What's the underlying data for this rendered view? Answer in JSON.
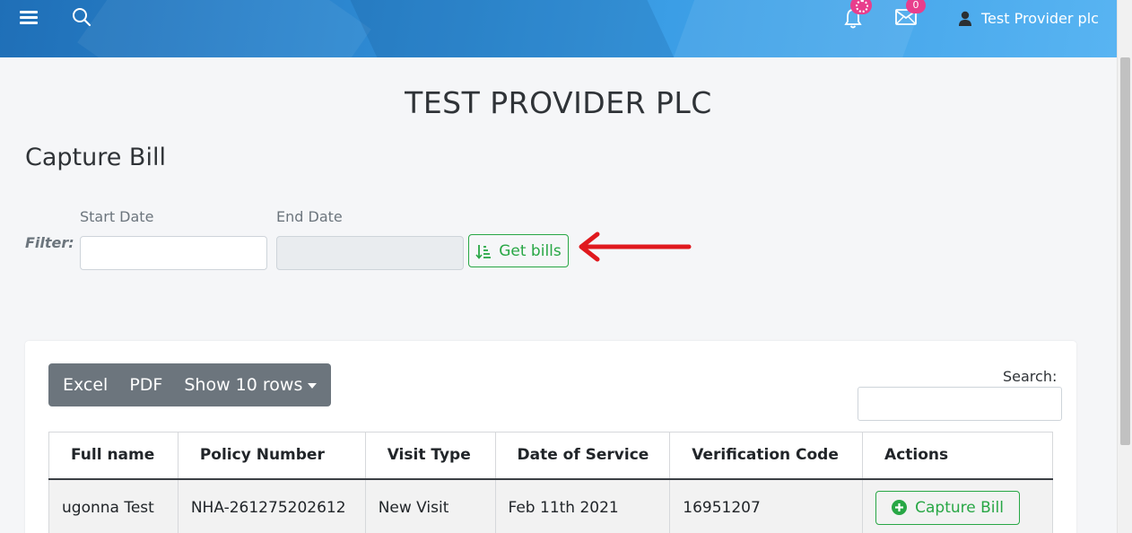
{
  "header": {
    "user_name": "Test Provider plc",
    "mail_count": "0",
    "accent_color": "#2e8ad3"
  },
  "page": {
    "company_name": "TEST PROVIDER PLC",
    "title": "Capture Bill"
  },
  "filter": {
    "label": "Filter:",
    "start_label": "Start Date",
    "start_value": "",
    "end_label": "End Date",
    "end_value": "",
    "get_bills_label": "Get bills"
  },
  "table_tools": {
    "excel_label": "Excel",
    "pdf_label": "PDF",
    "rows_label": "Show 10 rows",
    "search_label": "Search:"
  },
  "table": {
    "headers": [
      "Full name",
      "Policy Number",
      "Visit Type",
      "Date of Service",
      "Verification Code",
      "Actions"
    ],
    "rows": [
      {
        "full_name": "ugonna Test",
        "policy_number": "NHA-261275202612",
        "visit_type": "New Visit",
        "date_of_service": "Feb 11th 2021",
        "verification_code": "16951207",
        "action_label": "Capture Bill"
      }
    ]
  }
}
